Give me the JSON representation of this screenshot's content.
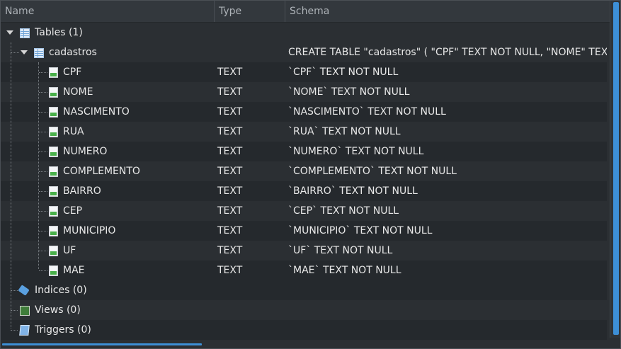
{
  "columns": {
    "name": "Name",
    "type": "Type",
    "schema": "Schema"
  },
  "tree": {
    "tables": {
      "label": "Tables (1)"
    },
    "table": {
      "name": "cadastros",
      "schema": "CREATE TABLE \"cadastros\" ( \"CPF\" TEXT NOT NULL, \"NOME\" TEXT NOT NULL,"
    },
    "fields": [
      {
        "name": "CPF",
        "type": "TEXT",
        "schema": "`CPF` TEXT NOT NULL"
      },
      {
        "name": "NOME",
        "type": "TEXT",
        "schema": "`NOME` TEXT NOT NULL"
      },
      {
        "name": "NASCIMENTO",
        "type": "TEXT",
        "schema": "`NASCIMENTO` TEXT NOT NULL"
      },
      {
        "name": "RUA",
        "type": "TEXT",
        "schema": "`RUA` TEXT NOT NULL"
      },
      {
        "name": "NUMERO",
        "type": "TEXT",
        "schema": "`NUMERO` TEXT NOT NULL"
      },
      {
        "name": "COMPLEMENTO",
        "type": "TEXT",
        "schema": "`COMPLEMENTO` TEXT NOT NULL"
      },
      {
        "name": "BAIRRO",
        "type": "TEXT",
        "schema": "`BAIRRO` TEXT NOT NULL"
      },
      {
        "name": "CEP",
        "type": "TEXT",
        "schema": "`CEP` TEXT NOT NULL"
      },
      {
        "name": "MUNICIPIO",
        "type": "TEXT",
        "schema": "`MUNICIPIO` TEXT NOT NULL"
      },
      {
        "name": "UF",
        "type": "TEXT",
        "schema": "`UF` TEXT NOT NULL"
      },
      {
        "name": "MAE",
        "type": "TEXT",
        "schema": "`MAE` TEXT NOT NULL"
      }
    ],
    "indices": {
      "label": "Indices (0)"
    },
    "views": {
      "label": "Views (0)"
    },
    "triggers": {
      "label": "Triggers (0)"
    }
  },
  "icons": {
    "table": "table-icon",
    "field": "field-icon",
    "index": "tag-icon",
    "view": "view-icon",
    "trigger": "trigger-icon"
  },
  "colors": {
    "accent": "#3d8fd6",
    "background": "#2b2f33",
    "alt_row": "#25292d"
  }
}
